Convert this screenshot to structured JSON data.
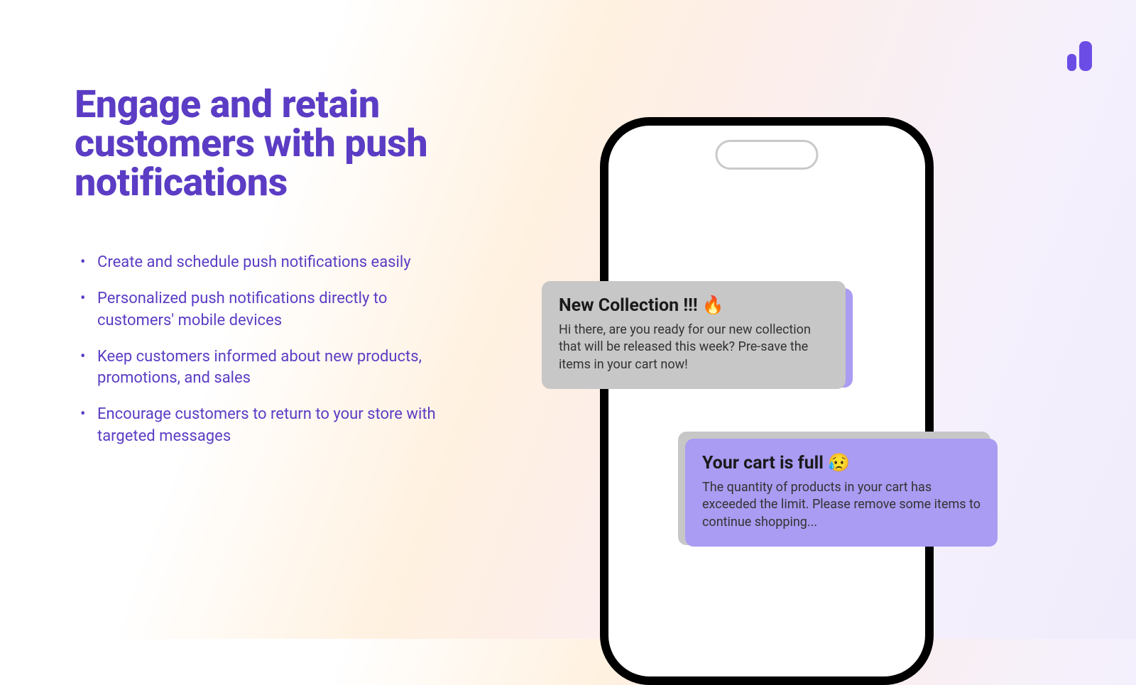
{
  "heading": "Engage and retain customers with push notifications",
  "bullets": [
    "Create and schedule push notifications easily",
    "Personalized push notifications directly to customers' mobile devices",
    "Keep customers informed about new products, promotions, and sales",
    "Encourage customers to return to your store with targeted messages"
  ],
  "notifications": [
    {
      "title": "New Collection !!! 🔥",
      "body": "Hi there, are you ready for our new collection that will be released this week? Pre-save the items in your cart now!"
    },
    {
      "title": "Your cart is full 😥",
      "body": "The quantity of products in your cart has exceeded the limit. Please remove some items to continue shopping..."
    }
  ]
}
